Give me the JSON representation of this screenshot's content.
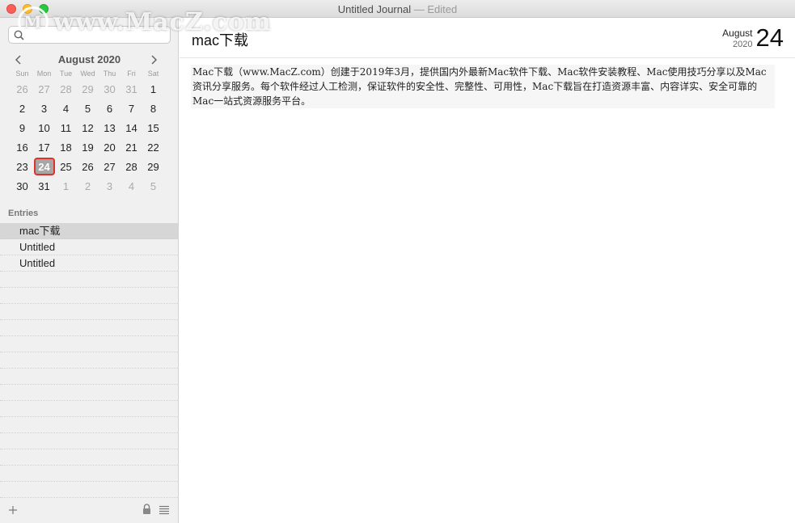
{
  "window": {
    "title": "Untitled Journal",
    "edited": "— Edited"
  },
  "watermark": {
    "text": "www.MacZ.com",
    "logo_letter": "M"
  },
  "calendar": {
    "month_label": "August 2020",
    "weekdays": [
      "Sun",
      "Mon",
      "Tue",
      "Wed",
      "Thu",
      "Fri",
      "Sat"
    ],
    "weeks": [
      [
        "26",
        "27",
        "28",
        "29",
        "30",
        "31",
        "1"
      ],
      [
        "2",
        "3",
        "4",
        "5",
        "6",
        "7",
        "8"
      ],
      [
        "9",
        "10",
        "11",
        "12",
        "13",
        "14",
        "15"
      ],
      [
        "16",
        "17",
        "18",
        "19",
        "20",
        "21",
        "22"
      ],
      [
        "23",
        "24",
        "25",
        "26",
        "27",
        "28",
        "29"
      ],
      [
        "30",
        "31",
        "1",
        "2",
        "3",
        "4",
        "5"
      ]
    ],
    "muted_days": [
      [
        0,
        0
      ],
      [
        0,
        1
      ],
      [
        0,
        2
      ],
      [
        0,
        3
      ],
      [
        0,
        4
      ],
      [
        0,
        5
      ],
      [
        5,
        2
      ],
      [
        5,
        3
      ],
      [
        5,
        4
      ],
      [
        5,
        5
      ],
      [
        5,
        6
      ]
    ],
    "today": [
      4,
      1
    ]
  },
  "entries": {
    "label": "Entries",
    "items": [
      "mac下载",
      "Untitled",
      "Untitled"
    ],
    "selected_index": 0
  },
  "main": {
    "title": "mac下载",
    "date_month": "August",
    "date_year": "2020",
    "date_day": "24",
    "body": "Mac下载（www.MacZ.com）创建于2019年3月，提供国内外最新Mac软件下载、Mac软件安装教程、Mac使用技巧分享以及Mac资讯分享服务。每个软件经过人工检测，保证软件的安全性、完整性、可用性，Mac下载旨在打造资源丰富、内容详实、安全可靠的Mac一站式资源服务平台。"
  },
  "colors": {
    "today_border": "#e0302a",
    "selected_row": "#d6d6d6"
  }
}
